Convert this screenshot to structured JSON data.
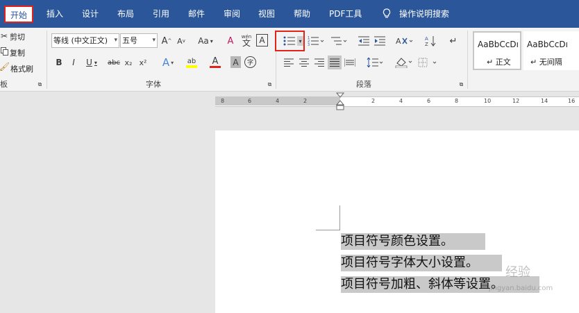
{
  "tabs": [
    "开始",
    "插入",
    "设计",
    "布局",
    "引用",
    "邮件",
    "审阅",
    "视图",
    "帮助",
    "PDF工具",
    "操作说明搜索"
  ],
  "clipboard": {
    "cut": "剪切",
    "copy": "复制",
    "format_painter": "格式刷",
    "group_label": "板"
  },
  "font": {
    "family": "等线 (中文正文)",
    "size": "五号",
    "grow": "A",
    "shrink": "A",
    "case": "Aa",
    "clear_format": "A",
    "phonetic_base": "文",
    "phonetic_ruby": "wén",
    "char_border": "A",
    "bold": "B",
    "italic": "I",
    "underline": "U",
    "strike": "abc",
    "subscript": "x₂",
    "superscript": "x²",
    "text_effect": "A",
    "highlight": "ab",
    "font_color": "A",
    "char_shading": "A",
    "enclose": "字",
    "group_label": "字体"
  },
  "paragraph": {
    "group_label": "段落"
  },
  "styles": [
    {
      "preview": "AaBbCcDı",
      "label": "正文"
    },
    {
      "preview": "AaBbCcDı",
      "label": "无间隔"
    }
  ],
  "ruler_ticks": [
    "8",
    "6",
    "4",
    "2",
    "2",
    "4",
    "6",
    "8",
    "10",
    "12",
    "14",
    "16"
  ],
  "document": {
    "lines": [
      "项目符号颜色设置。",
      "项目符号字体大小设置。",
      "项目符号加粗、斜体等设置。"
    ]
  },
  "watermark": {
    "text": "经验",
    "url": "jingyan.baidu.com"
  },
  "colors": {
    "tab_bg": "#2b579a",
    "highlight": "#e2231a",
    "selection": "#c9c9c9"
  }
}
